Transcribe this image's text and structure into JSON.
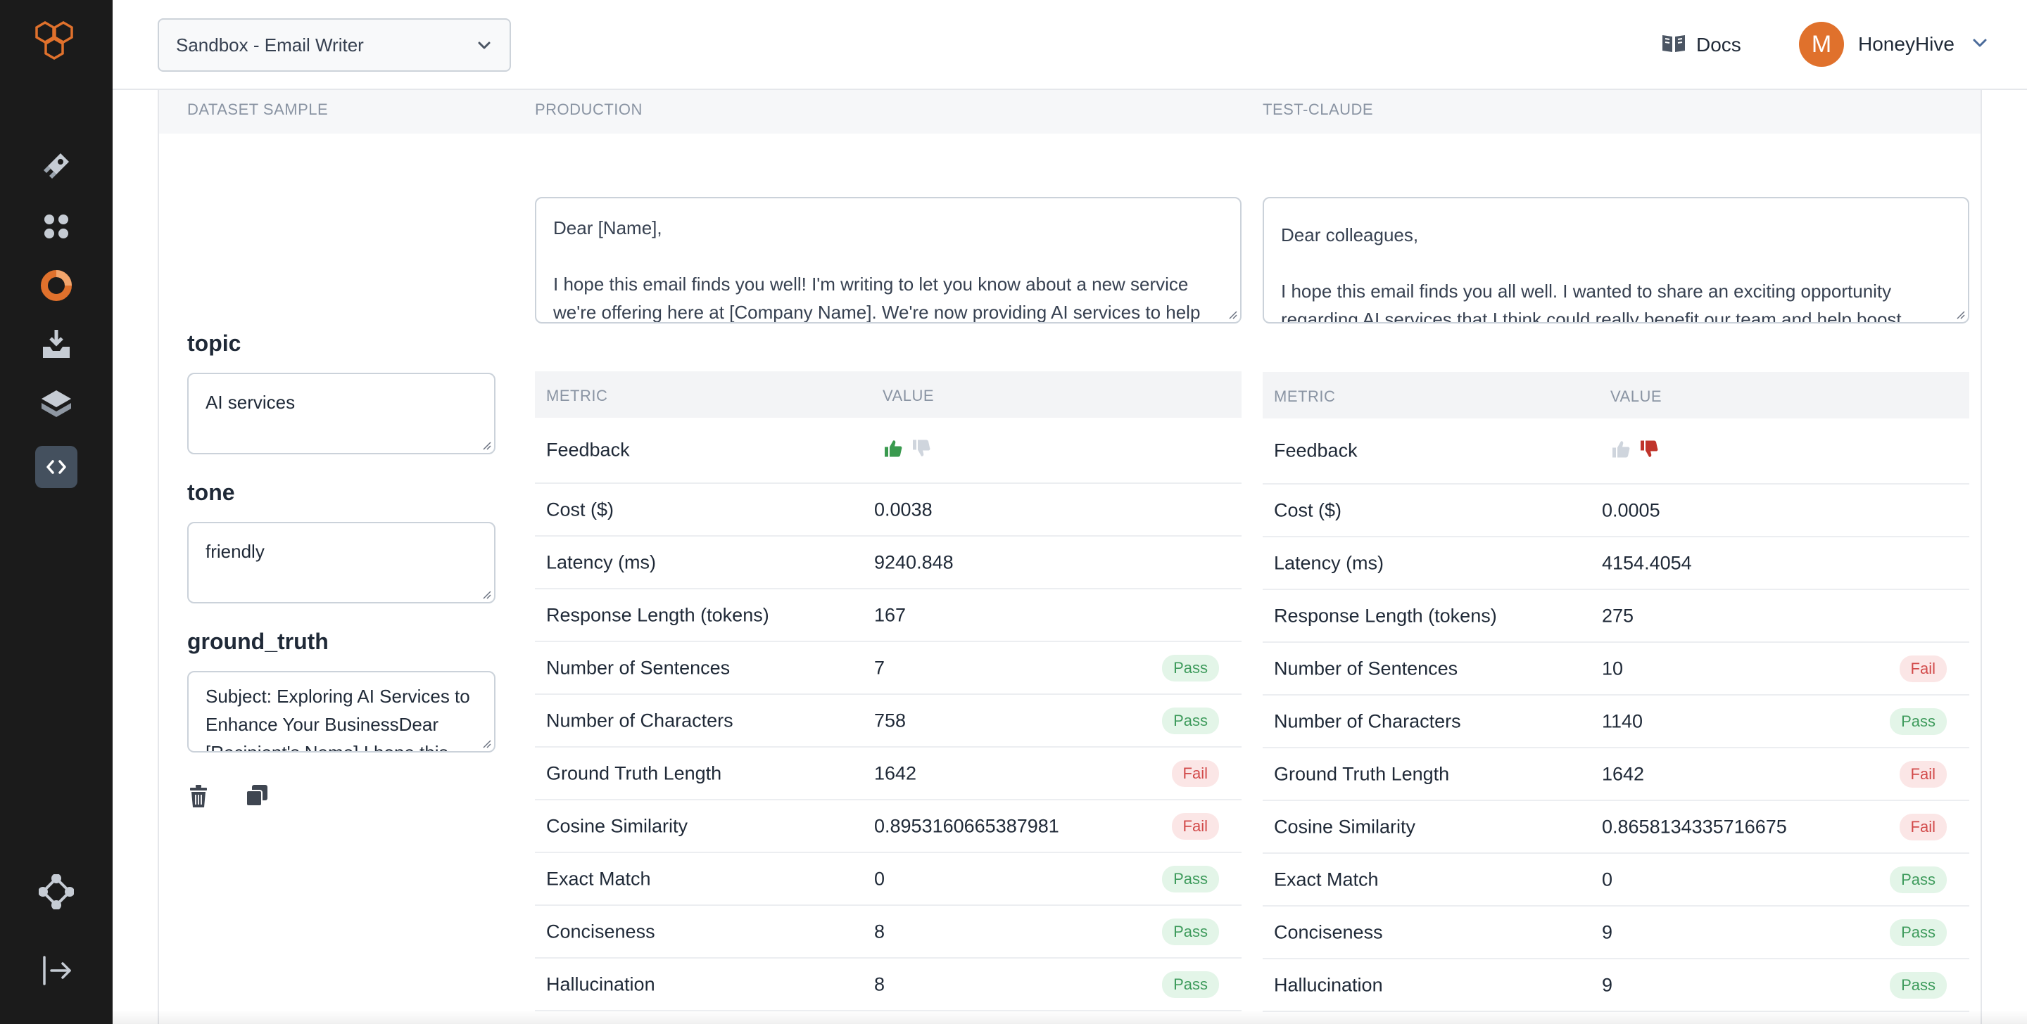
{
  "header": {
    "project_select": "Sandbox - Email Writer",
    "docs_label": "Docs",
    "user_initial": "M",
    "user_name": "HoneyHive"
  },
  "sidebar": {
    "items": [
      {
        "icon": "rocket-icon"
      },
      {
        "icon": "grid-dots-icon"
      },
      {
        "icon": "chart-donut-icon"
      },
      {
        "icon": "inbox-download-icon"
      },
      {
        "icon": "layers-icon"
      },
      {
        "icon": "code-icon",
        "active": true
      },
      {
        "icon": "nodes-icon"
      },
      {
        "icon": "logout-icon"
      }
    ]
  },
  "columns": {
    "dataset": "DATASET SAMPLE",
    "production": "PRODUCTION",
    "test": "TEST-CLAUDE"
  },
  "sample": {
    "topic_label": "topic",
    "topic_value": "AI services",
    "tone_label": "tone",
    "tone_value": "friendly",
    "gt_label": "ground_truth",
    "gt_value_1": "Subject: Exploring AI Services to",
    "gt_value_2": "Enhance Your BusinessDear",
    "gt_value_3": "[Recipient's Name],I hope this"
  },
  "production": {
    "response_lines": [
      "Dear [Name],",
      "",
      "I hope this email finds you well! I'm writing to let you know about a new service",
      "we're offering here at [Company Name]. We're now providing AI services to help"
    ],
    "metric_header": "METRIC",
    "value_header": "VALUE",
    "metrics": [
      {
        "name": "Feedback",
        "value": "",
        "badge": ""
      },
      {
        "name": "Cost ($)",
        "value": "0.0038",
        "badge": ""
      },
      {
        "name": "Latency (ms)",
        "value": "9240.848",
        "badge": ""
      },
      {
        "name": "Response Length (tokens)",
        "value": "167",
        "badge": ""
      },
      {
        "name": "Number of Sentences",
        "value": "7",
        "badge": "Pass"
      },
      {
        "name": "Number of Characters",
        "value": "758",
        "badge": "Pass"
      },
      {
        "name": "Ground Truth Length",
        "value": "1642",
        "badge": "Fail"
      },
      {
        "name": "Cosine Similarity",
        "value": "0.8953160665387981",
        "badge": "Fail"
      },
      {
        "name": "Exact Match",
        "value": "0",
        "badge": "Pass"
      },
      {
        "name": "Conciseness",
        "value": "8",
        "badge": "Pass"
      },
      {
        "name": "Hallucination",
        "value": "8",
        "badge": "Pass"
      }
    ],
    "feedback": "thumbs-up"
  },
  "test": {
    "response_lines": [
      "Dear colleagues,",
      "",
      "I hope this email finds you all well. I wanted to share an exciting opportunity",
      "regarding AI services that I think could really benefit our team and help boost"
    ],
    "metric_header": "METRIC",
    "value_header": "VALUE",
    "metrics": [
      {
        "name": "Feedback",
        "value": "",
        "badge": ""
      },
      {
        "name": "Cost ($)",
        "value": "0.0005",
        "badge": ""
      },
      {
        "name": "Latency (ms)",
        "value": "4154.4054",
        "badge": ""
      },
      {
        "name": "Response Length (tokens)",
        "value": "275",
        "badge": ""
      },
      {
        "name": "Number of Sentences",
        "value": "10",
        "badge": "Fail"
      },
      {
        "name": "Number of Characters",
        "value": "1140",
        "badge": "Pass"
      },
      {
        "name": "Ground Truth Length",
        "value": "1642",
        "badge": "Fail"
      },
      {
        "name": "Cosine Similarity",
        "value": "0.8658134335716675",
        "badge": "Fail"
      },
      {
        "name": "Exact Match",
        "value": "0",
        "badge": "Pass"
      },
      {
        "name": "Conciseness",
        "value": "9",
        "badge": "Pass"
      },
      {
        "name": "Hallucination",
        "value": "9",
        "badge": "Pass"
      }
    ],
    "feedback": "thumbs-down"
  },
  "colors": {
    "accent": "#e0712c",
    "sidebar_bg": "#1b1b1b",
    "pass_bg": "#e3f5e8",
    "pass_fg": "#3e9b5c",
    "fail_bg": "#fbe6e6",
    "fail_fg": "#d24a4a",
    "thumb_up_active": "#3a9a4f",
    "thumb_down_active": "#c0342b",
    "thumb_inactive": "#cfd5dd"
  }
}
